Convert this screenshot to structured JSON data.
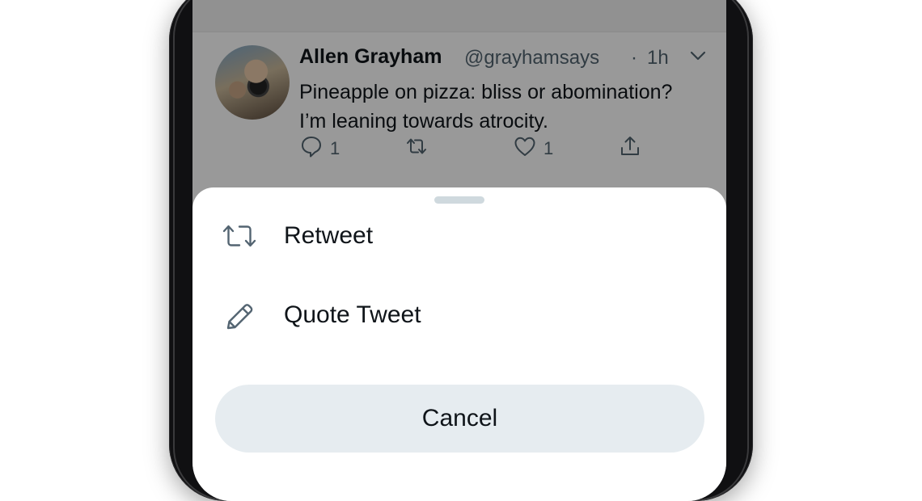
{
  "tweet": {
    "author_name": "Allen Grayham",
    "author_handle": "@grayhamsays",
    "separator": "·",
    "timestamp": "1h",
    "text_line1": "Pineapple on pizza: bliss or abomination?",
    "text_line2": "I’m leaning towards atrocity.",
    "reply_count": "1",
    "like_count": "1"
  },
  "sheet": {
    "retweet_label": "Retweet",
    "quote_label": "Quote Tweet",
    "cancel_label": "Cancel"
  },
  "icons": {
    "reply": "reply-icon",
    "retweet": "retweet-icon",
    "like": "heart-icon",
    "share": "share-icon",
    "quote": "pencil-icon",
    "more": "chevron-down-icon"
  },
  "colors": {
    "text_primary": "#0f1419",
    "text_secondary": "#536471",
    "cancel_bg": "#e6ecf0",
    "overlay": "rgba(0,0,0,0.40)"
  }
}
